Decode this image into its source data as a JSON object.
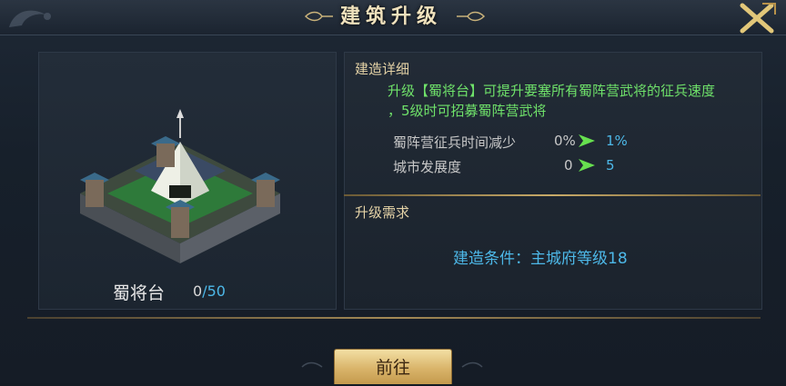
{
  "title": "建筑升级",
  "building": {
    "name": "蜀将台",
    "count_current": "0",
    "count_max": "/50"
  },
  "detail": {
    "heading": "建造详细",
    "description_line1": "升级【蜀将台】可提升要塞所有蜀阵营武将的征兵速度",
    "description_line2": "，5级时可招募蜀阵营武将",
    "stats": [
      {
        "label": "蜀阵营征兵时间减少",
        "current": "0%",
        "next": "1%"
      },
      {
        "label": "城市发展度",
        "current": "0",
        "next": "5"
      }
    ]
  },
  "requirement": {
    "heading": "升级需求",
    "condition": "建造条件：主城府等级18"
  },
  "go_button": "前往",
  "colors": {
    "accent_blue": "#4db8e8",
    "accent_green": "#6fe26a",
    "gold": "#e4d2a6"
  },
  "icons": {
    "close": "close-icon",
    "arrow": "arrow-right-icon"
  }
}
